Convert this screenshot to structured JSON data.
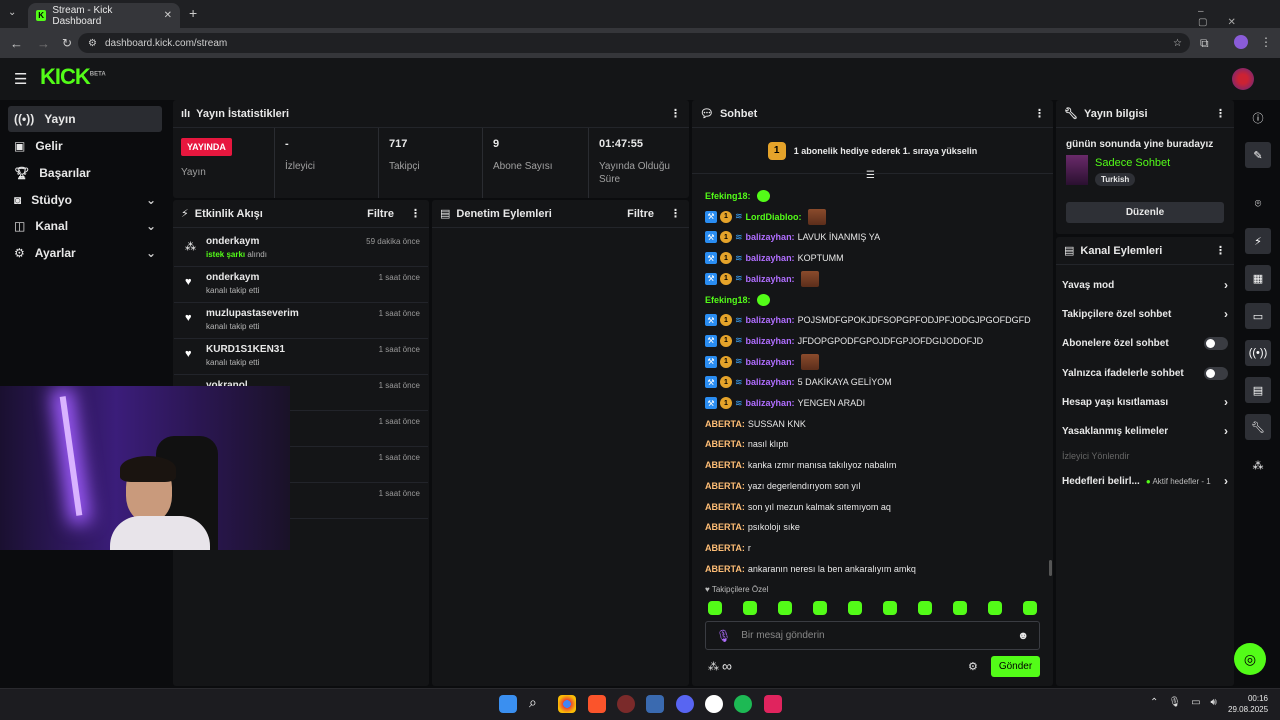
{
  "browser": {
    "tab_title": "Stream - Kick Dashboard",
    "url": "dashboard.kick.com/stream"
  },
  "logo": {
    "text": "KICK",
    "badge": "BETA"
  },
  "nav": [
    {
      "label": "Yayın"
    },
    {
      "label": "Gelir"
    },
    {
      "label": "Başarılar"
    },
    {
      "label": "Stüdyo"
    },
    {
      "label": "Kanal"
    },
    {
      "label": "Ayarlar"
    }
  ],
  "stats": {
    "title": "Yayın İstatistikleri",
    "live_badge": "YAYINDA",
    "live_label": "Yayın",
    "viewers_value": "-",
    "viewers_label": "İzleyici",
    "followers_value": "717",
    "followers_label": "Takipçi",
    "subs_value": "9",
    "subs_label": "Abone Sayısı",
    "duration_value": "01:47:55",
    "duration_label": "Yayında Olduğu Süre"
  },
  "activity": {
    "title": "Etkinlik Akışı",
    "filter": "Filtre",
    "items": [
      {
        "name": "onderkaym",
        "sub_hl": "istek şarkı",
        "sub": " alındı",
        "time": "59 dakika önce"
      },
      {
        "name": "onderkaym",
        "sub_hl": "",
        "sub": "kanalı takip etti",
        "time": "1 saat önce"
      },
      {
        "name": "muzlupastaseverim",
        "sub_hl": "",
        "sub": "kanalı takip etti",
        "time": "1 saat önce"
      },
      {
        "name": "KURD1S1KEN31",
        "sub_hl": "",
        "sub": "kanalı takip etti",
        "time": "1 saat önce"
      },
      {
        "name": "yokranol",
        "sub_hl": "",
        "sub": "",
        "time": "1 saat önce"
      },
      {
        "name": "",
        "sub_hl": "",
        "sub": "",
        "time": "1 saat önce"
      },
      {
        "name": "",
        "sub_hl": "",
        "sub": "",
        "time": "1 saat önce"
      },
      {
        "name": "",
        "sub_hl": "",
        "sub": "",
        "time": "1 saat önce"
      }
    ]
  },
  "moderation": {
    "title": "Denetim Eylemleri",
    "filter": "Filtre"
  },
  "chat": {
    "title": "Sohbet",
    "pinned_rank": "1",
    "pinned_text": "1 abonelik hediye ederek 1. sıraya yükselin",
    "messages": [
      {
        "user": "Efeking18:",
        "cls": "u-green",
        "text": "",
        "badges": false,
        "emote": "gem"
      },
      {
        "user": "LordDiabloo:",
        "cls": "u-green",
        "text": "",
        "badges": true,
        "emote": "img"
      },
      {
        "user": "balizayhan:",
        "cls": "u-purple",
        "text": "LAVUK İNANMIŞ YA",
        "badges": true,
        "emote": ""
      },
      {
        "user": "balizayhan:",
        "cls": "u-purple",
        "text": "KOPTUMM",
        "badges": true,
        "emote": ""
      },
      {
        "user": "balizayhan:",
        "cls": "u-purple",
        "text": "",
        "badges": true,
        "emote": "img"
      },
      {
        "user": "Efeking18:",
        "cls": "u-green",
        "text": "",
        "badges": false,
        "emote": "gem"
      },
      {
        "user": "balizayhan:",
        "cls": "u-purple",
        "text": "POJSMDFGPOKJDFSOPGPFODJPFJODGJPGOFDGFD",
        "badges": true,
        "emote": ""
      },
      {
        "user": "balizayhan:",
        "cls": "u-purple",
        "text": "JFDOPGPODFGPOJDFGPJOFDGIJODOFJD",
        "badges": true,
        "emote": ""
      },
      {
        "user": "balizayhan:",
        "cls": "u-purple",
        "text": "",
        "badges": true,
        "emote": "img"
      },
      {
        "user": "balizayhan:",
        "cls": "u-purple",
        "text": "5 DAKİKAYA GELİYOM",
        "badges": true,
        "emote": ""
      },
      {
        "user": "balizayhan:",
        "cls": "u-purple",
        "text": "YENGEN ARADI",
        "badges": true,
        "emote": ""
      },
      {
        "user": "ABERTA:",
        "cls": "u-orange",
        "text": "SUSSAN KNK",
        "badges": false,
        "emote": ""
      },
      {
        "user": "ABERTA:",
        "cls": "u-orange",
        "text": "nasıl klıptı",
        "badges": false,
        "emote": ""
      },
      {
        "user": "ABERTA:",
        "cls": "u-orange",
        "text": "kanka ızmır manısa takılıyoz nabalım",
        "badges": false,
        "emote": ""
      },
      {
        "user": "ABERTA:",
        "cls": "u-orange",
        "text": "yazı degerlendırıyom son yıl",
        "badges": false,
        "emote": ""
      },
      {
        "user": "ABERTA:",
        "cls": "u-orange",
        "text": "son yıl mezun kalmak sıtemıyom aq",
        "badges": false,
        "emote": ""
      },
      {
        "user": "ABERTA:",
        "cls": "u-orange",
        "text": "psıkolojı sıke",
        "badges": false,
        "emote": ""
      },
      {
        "user": "ABERTA:",
        "cls": "u-orange",
        "text": "r",
        "badges": false,
        "emote": ""
      },
      {
        "user": "ABERTA:",
        "cls": "u-orange",
        "text": "ankaranın neresı la ben ankaralıyım amkq",
        "badges": false,
        "emote": ""
      }
    ],
    "followers_only": "♥ Takipçilere Özel",
    "input_placeholder": "Bir mesaj gönderin",
    "send": "Gönder",
    "infinity": "∞"
  },
  "stream_info": {
    "title": "Yayın bilgisi",
    "stream_title": "günün sonunda yine buradayız",
    "category": "Sadece Sohbet",
    "tag": "Turkish",
    "edit": "Düzenle"
  },
  "channel_actions": {
    "title": "Kanal Eylemleri",
    "items": [
      "Yavaş mod",
      "Takipçilere özel sohbet",
      "Abonelere özel sohbet",
      "Yalnızca ifadelerle sohbet",
      "Hesap yaşı kısıtlaması",
      "Yasaklanmış kelimeler"
    ],
    "section": "İzleyici Yönlendir",
    "goals": "Hedefleri belirl...",
    "goals_status": "Aktif hedefler - 1"
  },
  "taskbar": {
    "time": "00:16",
    "date": "29.08.2025"
  },
  "colors": {
    "brand": "#53fc18",
    "live": "#e7173e"
  }
}
